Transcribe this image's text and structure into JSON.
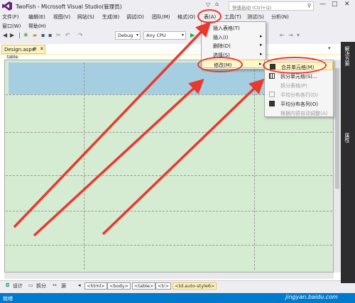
{
  "window": {
    "title": "TwoFish - Microsoft Visual Studio(管理员)",
    "quicklaunch_placeholder": "快速启动 (Ctrl+Q)",
    "minimize": "—",
    "maximize": "□",
    "close": "✕"
  },
  "menu": {
    "file": "文件(F)",
    "edit": "编辑(E)",
    "view": "视图(V)",
    "website": "网站(S)",
    "build": "生成(B)",
    "debug": "调试(D)",
    "team": "团队(M)",
    "format": "格式(O)",
    "table": "表(A)",
    "tools": "工具(T)",
    "test": "测试(S)",
    "analyze": "分析(N)",
    "window": "窗口(W)",
    "help": "帮助(H)"
  },
  "toolbar": {
    "config": "Debug",
    "platform": "Any CPU"
  },
  "doc": {
    "tab_label": "Design.aspx",
    "pin": "⊕",
    "close": "✕",
    "table_tag": "table"
  },
  "table_menu": {
    "insert_table": "插入表格(T)",
    "insert": "插入(I)",
    "delete": "删除(D)",
    "select": "选择(S)",
    "modify": "修改(M)"
  },
  "modify_menu": {
    "merge_cells": "合并单元格(M)",
    "split_cells": "拆分单元格(S)...",
    "split_table": "拆分表格(P)",
    "distribute_rows": "平均分布各行(D)",
    "distribute_columns": "平均分布各列(O)",
    "autofit": "根据内容自动调整(A)"
  },
  "viewbar": {
    "design": "设计",
    "split": "拆分",
    "source": "源",
    "crumbs": [
      "<html>",
      "<body>",
      "<table>",
      "<tr>",
      "<td.auto-style6>"
    ]
  },
  "side_panels": {
    "solution_explorer": "解决方案",
    "properties": "属性"
  },
  "statusbar": {
    "text": "就绪",
    "watermark": "jingyan.baidu.com"
  },
  "colors": {
    "status_blue": "#007acc",
    "annotation_red": "#e8392f",
    "highlight_yellow": "#fcf3c0",
    "design_green": "#d6ecd2",
    "header_blue": "#a5cfe0"
  }
}
